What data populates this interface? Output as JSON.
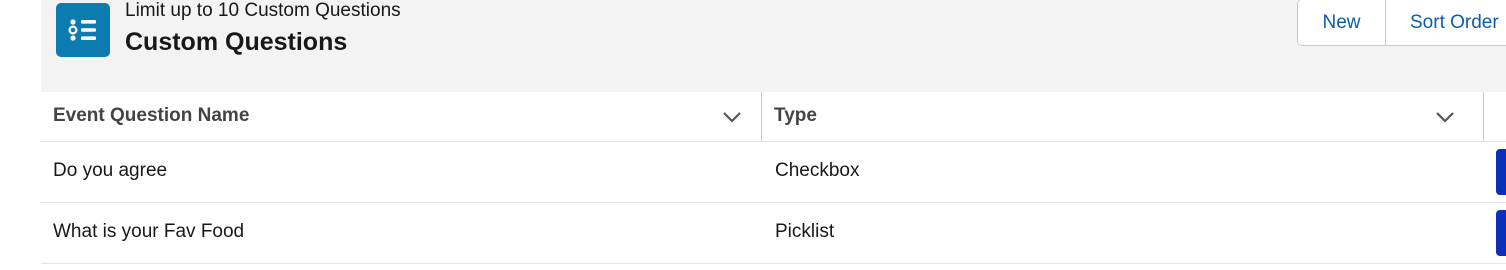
{
  "header": {
    "subtitle": "Limit up to 10 Custom Questions",
    "title": "Custom Questions",
    "icon": "list-icon",
    "icon_color": "#0b7bb0"
  },
  "actions": {
    "new_label": "New",
    "sort_order_label": "Sort Order"
  },
  "table": {
    "columns": [
      {
        "label": "Event Question Name"
      },
      {
        "label": "Type"
      }
    ],
    "rows": [
      {
        "name": "Do you agree",
        "type": "Checkbox"
      },
      {
        "name": "What is your Fav Food",
        "type": "Picklist"
      }
    ]
  },
  "colors": {
    "header_bg": "#f3f3f3",
    "link": "#0b5cab",
    "row_action": "#0b2fb8"
  }
}
